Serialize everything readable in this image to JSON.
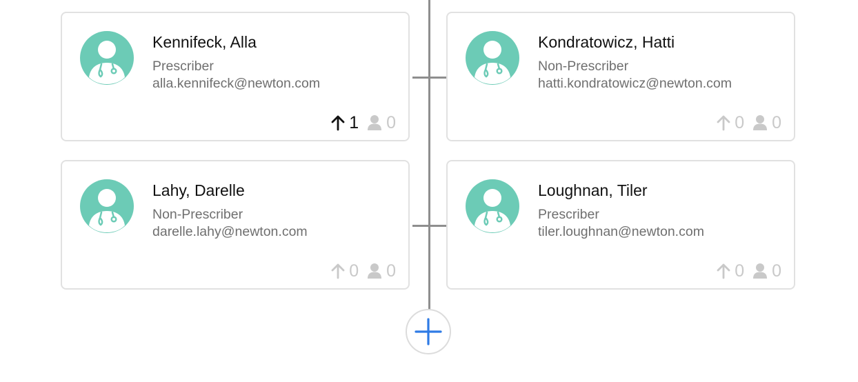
{
  "colors": {
    "avatar_bg": "#6ccbb6",
    "connector": "#8e8e8e",
    "add_accent": "#2f7be5",
    "stat_active": "#111111",
    "stat_inactive": "#c9c9c9"
  },
  "icons": {
    "avatar": "doctor-avatar-icon",
    "upline": "arrow-up-icon",
    "downline": "person-icon",
    "add": "plus-icon"
  },
  "members": [
    {
      "name": "Kennifeck, Alla",
      "role": "Prescriber",
      "email": "alla.kennifeck@newton.com",
      "up_count": "1",
      "people_count": "0"
    },
    {
      "name": "Kondratowicz, Hatti",
      "role": "Non-Prescriber",
      "email": "hatti.kondratowicz@newton.com",
      "up_count": "0",
      "people_count": "0"
    },
    {
      "name": "Lahy, Darelle",
      "role": "Non-Prescriber",
      "email": "darelle.lahy@newton.com",
      "up_count": "0",
      "people_count": "0"
    },
    {
      "name": "Loughnan, Tiler",
      "role": "Prescriber",
      "email": "tiler.loughnan@newton.com",
      "up_count": "0",
      "people_count": "0"
    }
  ]
}
